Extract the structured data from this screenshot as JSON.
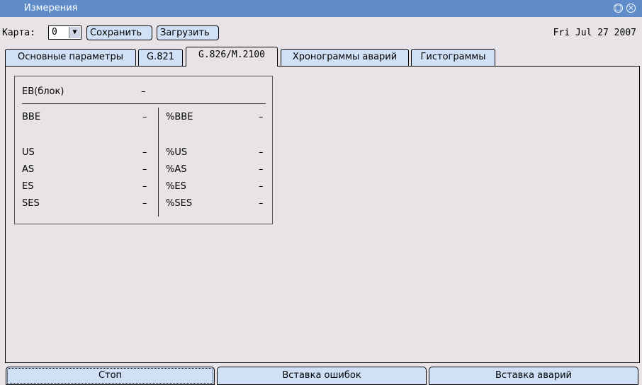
{
  "window": {
    "title": "Измерения",
    "restore_icon": "restore-icon",
    "close_icon": "close-icon"
  },
  "toolbar": {
    "card_label": "Карта:",
    "card_value": "0",
    "save_label": "Сохранить",
    "load_label": "Загрузить",
    "date": "Fri Jul 27 2007"
  },
  "tabs": [
    {
      "label": "Основные параметры"
    },
    {
      "label": "G.821"
    },
    {
      "label": "G.826/M.2100",
      "active": true
    },
    {
      "label": "Хронограммы аварий"
    },
    {
      "label": "Гистограммы"
    }
  ],
  "stats": {
    "eb": {
      "label": "EB(блок)",
      "value": "–"
    },
    "rows": [
      {
        "left_label": "BBE",
        "left_value": "–",
        "right_label": "%BBE",
        "right_value": "–"
      },
      {
        "left_label": "US",
        "left_value": "–",
        "right_label": "%US",
        "right_value": "–"
      },
      {
        "left_label": "AS",
        "left_value": "–",
        "right_label": "%AS",
        "right_value": "–"
      },
      {
        "left_label": "ES",
        "left_value": "–",
        "right_label": "%ES",
        "right_value": "–"
      },
      {
        "left_label": "SES",
        "left_value": "–",
        "right_label": "%SES",
        "right_value": "–"
      }
    ]
  },
  "bottom": {
    "stop_label": "Стоп",
    "insert_errors_label": "Вставка ошибок",
    "insert_alarms_label": "Вставка аварий"
  }
}
